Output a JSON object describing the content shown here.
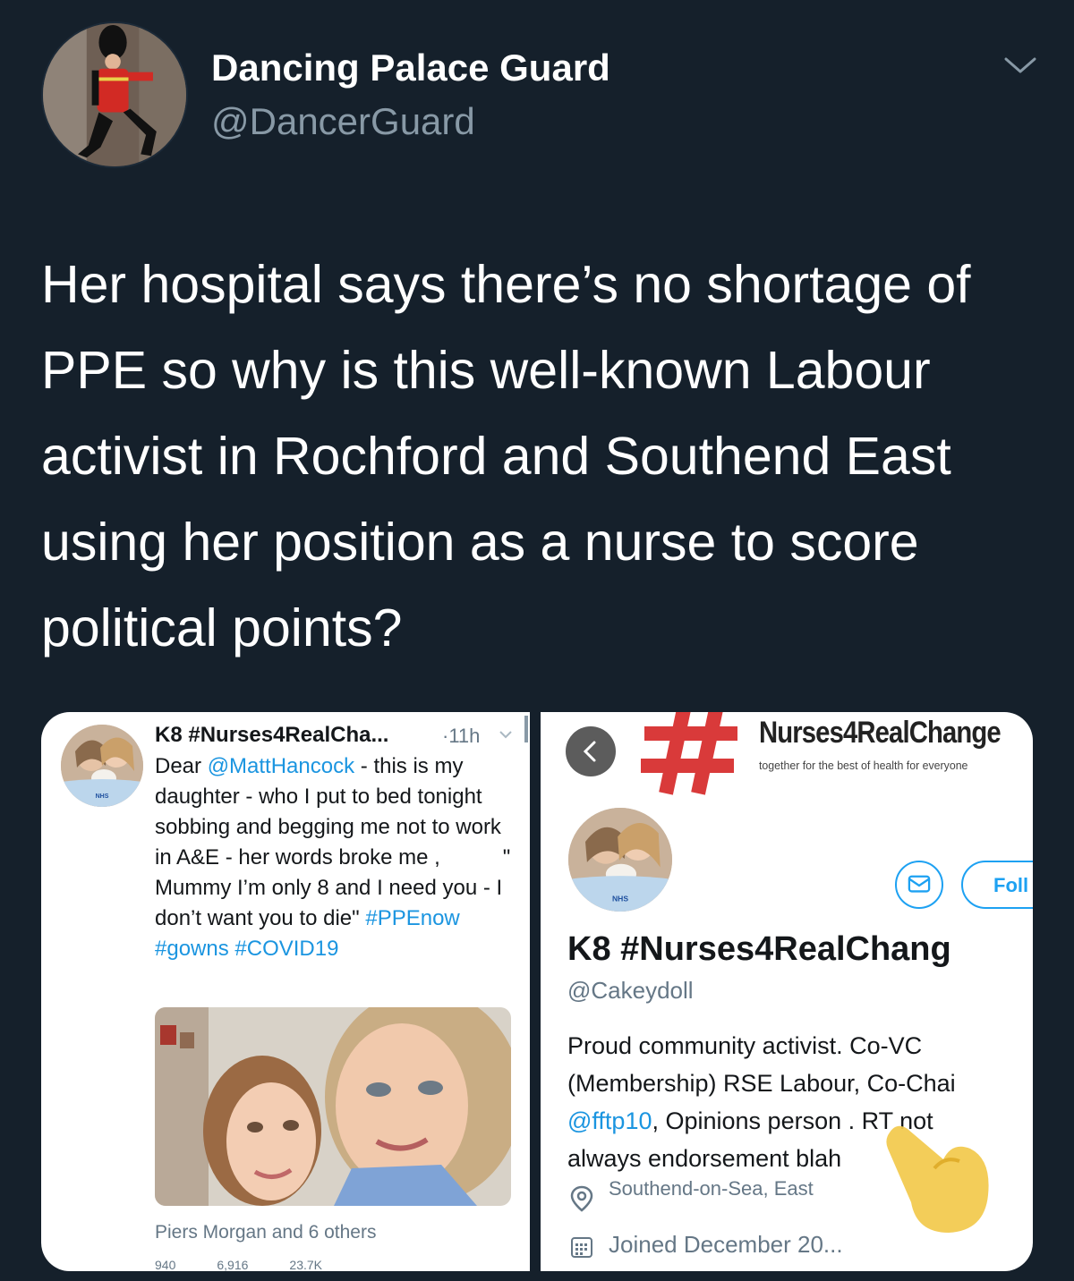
{
  "tweet": {
    "display_name": "Dancing Palace Guard",
    "handle": "@DancerGuard",
    "text": "Her hospital says there’s no shortage of PPE so why is this well-known Labour activist in Rochford and Southend East using her position as a nurse to score political points?"
  },
  "left_screenshot": {
    "name": "K8 #Nurses4RealCha...",
    "time": "·11h",
    "body": {
      "p1": "Dear ",
      "mention": "@MattHancock",
      "p2": " - this is my daughter - who I put to bed tonight sobbing and begging me not to work in A&E - her words broke me ,",
      "p3": "\" Mummy I’m only 8 and I need you - I don’t want you to die\" ",
      "tag1": "#PPEnow",
      "tag2": "#gowns",
      "tag3": "#COVID19"
    },
    "liked_by": "Piers Morgan and 6 others",
    "stats": [
      "940",
      "6,916",
      "23.7K"
    ]
  },
  "right_screenshot": {
    "brand": "Nurses4RealChange",
    "tagline": "together for the best of health for everyone",
    "follow_label": "Foll",
    "name": "K8 #Nurses4RealChang",
    "handle": "@Cakeydoll",
    "bio": {
      "line1": "Proud community activist. Co-VC",
      "line2": "(Membership) RSE Labour, Co-Chai",
      "mention": "@fftp10",
      "line3": ", Opinions person  . RT not",
      "line4": "always endorsement blah"
    },
    "location": "Southend-on-Sea, East",
    "joined": "Joined December 20..."
  },
  "colors": {
    "background": "#15202b",
    "secondary_text": "#8899a6",
    "link": "#1b95e0",
    "brand_red": "#d93a3a"
  }
}
